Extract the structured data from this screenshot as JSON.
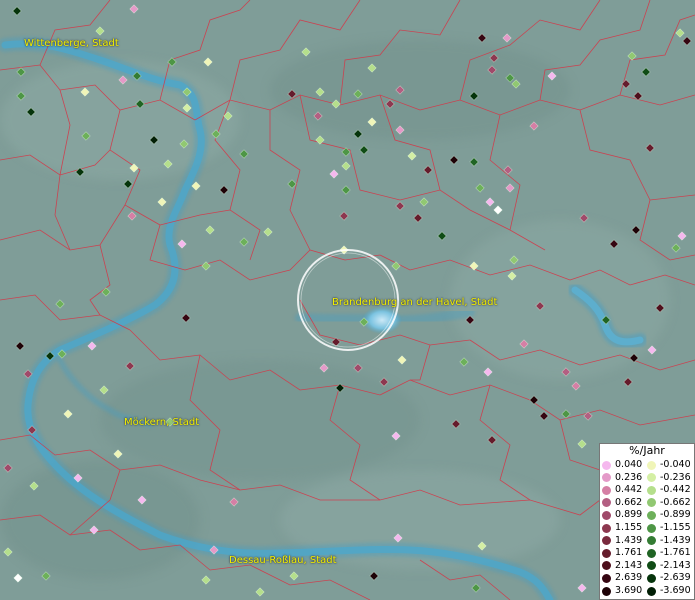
{
  "cities": [
    {
      "label": "Wittenberge, Stadt"
    },
    {
      "label": "Brandenburg an der Havel, Stadt"
    },
    {
      "label": "Möckern, Stadt"
    },
    {
      "label": "Dessau-Roßlau, Stadt"
    }
  ],
  "legend": {
    "title": "%/Jahr",
    "positive": [
      {
        "value": "0.040",
        "color": "#f5b8ee"
      },
      {
        "value": "0.236",
        "color": "#e49ac8"
      },
      {
        "value": "0.442",
        "color": "#d57fa5"
      },
      {
        "value": "0.662",
        "color": "#b35f82"
      },
      {
        "value": "0.899",
        "color": "#a04a6a"
      },
      {
        "value": "1.155",
        "color": "#8d3850"
      },
      {
        "value": "1.439",
        "color": "#7a2a3e"
      },
      {
        "value": "1.761",
        "color": "#651c2c"
      },
      {
        "value": "2.143",
        "color": "#4e0f1c"
      },
      {
        "value": "2.639",
        "color": "#360612"
      },
      {
        "value": "3.690",
        "color": "#1e0207"
      }
    ],
    "negative": [
      {
        "value": "-0.040",
        "color": "#f0f5b8"
      },
      {
        "value": "-0.236",
        "color": "#d4efa4"
      },
      {
        "value": "-0.442",
        "color": "#b5df8c"
      },
      {
        "value": "-0.662",
        "color": "#91c872"
      },
      {
        "value": "-0.899",
        "color": "#6db05a"
      },
      {
        "value": "-1.155",
        "color": "#4e9646"
      },
      {
        "value": "-1.439",
        "color": "#347c34"
      },
      {
        "value": "-1.761",
        "color": "#206424"
      },
      {
        "value": "-2.143",
        "color": "#104c16"
      },
      {
        "value": "-2.639",
        "color": "#06340c"
      },
      {
        "value": "-3.690",
        "color": "#021f06"
      }
    ]
  },
  "colors": {
    "background": "#7f9d98",
    "river": "#3f9ec8",
    "boundary": "#d23a4a",
    "label": "#f2f200"
  }
}
